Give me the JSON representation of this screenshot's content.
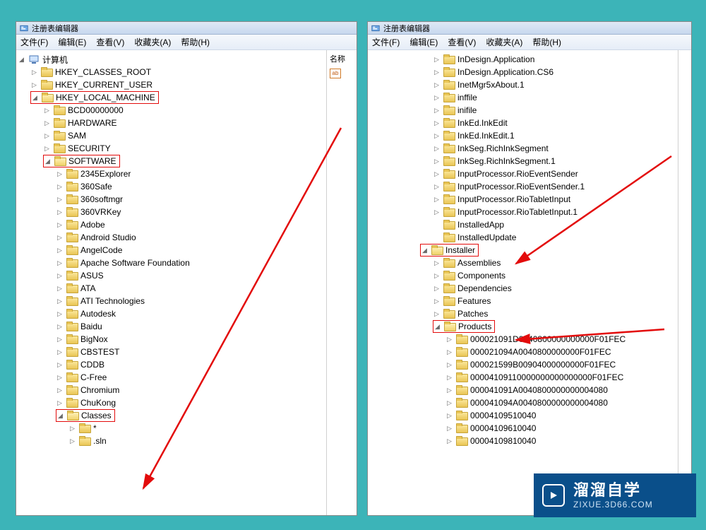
{
  "window_title": "注册表编辑器",
  "menu": {
    "file": "文件(F)",
    "edit": "编辑(E)",
    "view": "查看(V)",
    "favorites": "收藏夹(A)",
    "help": "帮助(H)"
  },
  "right_pane": {
    "col_name": "名称",
    "val_sample": "ab"
  },
  "left_tree": {
    "root": "计算机",
    "items": [
      {
        "label": "HKEY_CLASSES_ROOT",
        "state": "collapsed"
      },
      {
        "label": "HKEY_CURRENT_USER",
        "state": "collapsed"
      },
      {
        "label": "HKEY_LOCAL_MACHINE",
        "state": "expanded",
        "hl": true,
        "children": [
          {
            "label": "BCD00000000",
            "state": "collapsed"
          },
          {
            "label": "HARDWARE",
            "state": "collapsed"
          },
          {
            "label": "SAM",
            "state": "collapsed"
          },
          {
            "label": "SECURITY",
            "state": "collapsed"
          },
          {
            "label": "SOFTWARE",
            "state": "expanded",
            "hl": true,
            "children": [
              {
                "label": "2345Explorer",
                "state": "collapsed"
              },
              {
                "label": "360Safe",
                "state": "collapsed"
              },
              {
                "label": "360softmgr",
                "state": "collapsed"
              },
              {
                "label": "360VRKey",
                "state": "collapsed"
              },
              {
                "label": "Adobe",
                "state": "collapsed"
              },
              {
                "label": "Android Studio",
                "state": "collapsed"
              },
              {
                "label": "AngelCode",
                "state": "collapsed"
              },
              {
                "label": "Apache Software Foundation",
                "state": "collapsed"
              },
              {
                "label": "ASUS",
                "state": "collapsed"
              },
              {
                "label": "ATA",
                "state": "collapsed"
              },
              {
                "label": "ATI Technologies",
                "state": "collapsed"
              },
              {
                "label": "Autodesk",
                "state": "collapsed"
              },
              {
                "label": "Baidu",
                "state": "collapsed"
              },
              {
                "label": "BigNox",
                "state": "collapsed"
              },
              {
                "label": "CBSTEST",
                "state": "collapsed"
              },
              {
                "label": "CDDB",
                "state": "collapsed"
              },
              {
                "label": "C-Free",
                "state": "collapsed"
              },
              {
                "label": "Chromium",
                "state": "collapsed"
              },
              {
                "label": "ChuKong",
                "state": "collapsed"
              },
              {
                "label": "Classes",
                "state": "expanded",
                "hl": true,
                "children": [
                  {
                    "label": "*",
                    "state": "collapsed"
                  },
                  {
                    "label": ".sln",
                    "state": "collapsed"
                  }
                ]
              }
            ]
          }
        ]
      }
    ]
  },
  "right_tree": {
    "items": [
      {
        "label": "InDesign.Application",
        "state": "collapsed",
        "indent": 1
      },
      {
        "label": "InDesign.Application.CS6",
        "state": "collapsed",
        "indent": 1
      },
      {
        "label": "InetMgr5xAbout.1",
        "state": "collapsed",
        "indent": 1
      },
      {
        "label": "inffile",
        "state": "collapsed",
        "indent": 1
      },
      {
        "label": "inifile",
        "state": "collapsed",
        "indent": 1
      },
      {
        "label": "InkEd.InkEdit",
        "state": "collapsed",
        "indent": 1
      },
      {
        "label": "InkEd.InkEdit.1",
        "state": "collapsed",
        "indent": 1
      },
      {
        "label": "InkSeg.RichInkSegment",
        "state": "collapsed",
        "indent": 1
      },
      {
        "label": "InkSeg.RichInkSegment.1",
        "state": "collapsed",
        "indent": 1
      },
      {
        "label": "InputProcessor.RioEventSender",
        "state": "collapsed",
        "indent": 1
      },
      {
        "label": "InputProcessor.RioEventSender.1",
        "state": "collapsed",
        "indent": 1
      },
      {
        "label": "InputProcessor.RioTabletInput",
        "state": "collapsed",
        "indent": 1
      },
      {
        "label": "InputProcessor.RioTabletInput.1",
        "state": "collapsed",
        "indent": 1
      },
      {
        "label": "InstalledApp",
        "state": "leaf",
        "indent": 1
      },
      {
        "label": "InstalledUpdate",
        "state": "leaf",
        "indent": 1
      },
      {
        "label": "Installer",
        "state": "expanded",
        "hl": true,
        "indent": 0,
        "children": [
          {
            "label": "Assemblies",
            "state": "collapsed"
          },
          {
            "label": "Components",
            "state": "collapsed"
          },
          {
            "label": "Dependencies",
            "state": "collapsed"
          },
          {
            "label": "Features",
            "state": "collapsed"
          },
          {
            "label": "Patches",
            "state": "collapsed"
          },
          {
            "label": "Products",
            "state": "expanded",
            "hl": true,
            "children": [
              {
                "label": "000021091D0040800000000000F01FEC",
                "state": "collapsed"
              },
              {
                "label": "000021094A0040800000000F01FEC",
                "state": "collapsed"
              },
              {
                "label": "000021599B00904000000000F01FEC",
                "state": "collapsed"
              },
              {
                "label": "00004109110000000000000000F01FEC",
                "state": "collapsed"
              },
              {
                "label": "000041091A0040800000000004080",
                "state": "collapsed"
              },
              {
                "label": "000041094A0040800000000004080",
                "state": "collapsed"
              },
              {
                "label": "00004109510040",
                "state": "collapsed"
              },
              {
                "label": "00004109610040",
                "state": "collapsed"
              },
              {
                "label": "00004109810040",
                "state": "collapsed"
              }
            ]
          }
        ]
      }
    ]
  },
  "watermark": {
    "cn": "溜溜自学",
    "url": "ZIXUE.3D66.COM"
  }
}
